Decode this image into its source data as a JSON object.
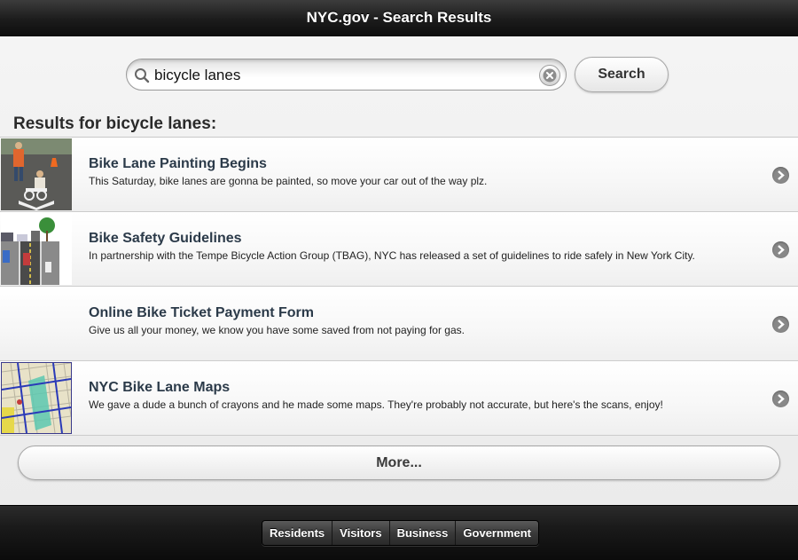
{
  "header": {
    "title": "NYC.gov - Search Results"
  },
  "search": {
    "value": "bicycle lanes",
    "button_label": "Search"
  },
  "results_heading": "Results for bicycle lanes:",
  "results": [
    {
      "title": "Bike Lane Painting Begins",
      "description": "This Saturday, bike lanes are gonna be painted, so move your car out of the way plz.",
      "thumbnail": "bike-lane-painting-photo"
    },
    {
      "title": "Bike Safety Guidelines",
      "description": "In partnership with the Tempe Bicycle Action Group (TBAG), NYC has released a set of guidelines to ride safely in New York City.",
      "thumbnail": "street-diagram-illustration"
    },
    {
      "title": "Online Bike Ticket Payment Form",
      "description": "Give us all your money, we know you have some saved from not paying for gas.",
      "thumbnail": ""
    },
    {
      "title": "NYC Bike Lane Maps",
      "description": "We gave a dude a bunch of crayons and he made some maps. They're probably not accurate, but here's the scans, enjoy!",
      "thumbnail": "bike-lane-map"
    }
  ],
  "more_label": "More...",
  "footer_nav": [
    "Residents",
    "Visitors",
    "Business",
    "Government"
  ],
  "colors": {
    "header_bg": "#1c1c1c",
    "title_text": "#2b3a49",
    "chevron": "#888888"
  }
}
